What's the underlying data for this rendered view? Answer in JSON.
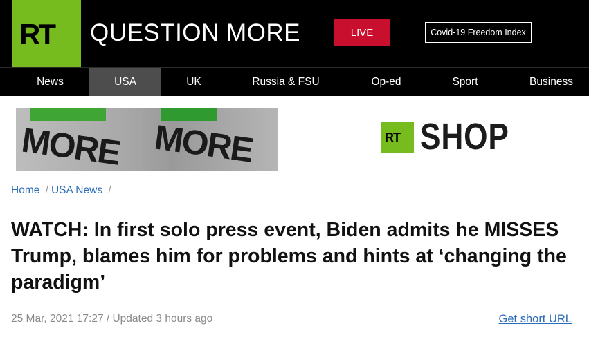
{
  "header": {
    "logo": "RT",
    "tagline": "QUESTION MORE",
    "live_label": "LIVE",
    "covid_label": "Covid-19 Freedom Index"
  },
  "nav": {
    "items": [
      {
        "label": "News"
      },
      {
        "label": "USA"
      },
      {
        "label": "UK"
      },
      {
        "label": "Russia & FSU"
      },
      {
        "label": "Op-ed"
      },
      {
        "label": "Sport"
      },
      {
        "label": "Business"
      }
    ],
    "active": "USA"
  },
  "banner": {
    "logo": "RT",
    "shop_label": "SHOP",
    "hoodie_text": "MORE"
  },
  "breadcrumb": {
    "home": "Home",
    "section": "USA News",
    "separator": "/"
  },
  "article": {
    "title": "WATCH: In first solo press event, Biden admits he MISSES Trump, blames him for problems and hints at ‘changing the paradigm’",
    "date": "25 Mar, 2021 17:27 / Updated 3 hours ago",
    "short_url_label": "Get short URL"
  },
  "colors": {
    "brand_green": "#77bc1f",
    "live_red": "#c8102e",
    "link_blue": "#2b6cb8",
    "nav_active": "#4d4d4d"
  }
}
